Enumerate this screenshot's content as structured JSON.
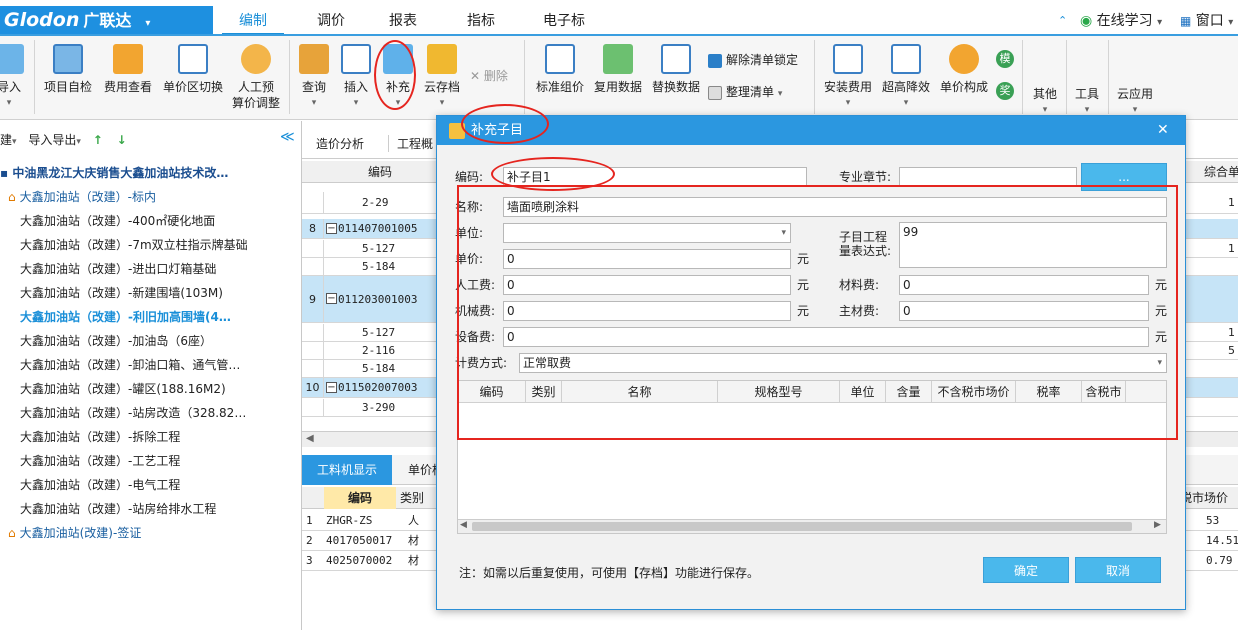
{
  "app": {
    "logo": "Glodon",
    "logo_cn": "广联达",
    "logo_caret": "▾"
  },
  "menu_tabs": [
    "编制",
    "调价",
    "报表",
    "指标",
    "电子标"
  ],
  "top_right": {
    "online": "在线学习",
    "window": "窗口"
  },
  "ribbon": {
    "import": "导入",
    "self_check": "项目自检",
    "fee_view": "费用查看",
    "price_zone": "单价区切换",
    "labor_adjust_1": "人工预",
    "labor_adjust_2": "算价调整",
    "query": "查询",
    "insert": "插入",
    "supplement": "补充",
    "cloud_save": "云存档",
    "delete": "删除",
    "std_price": "标准组价",
    "reuse": "复用数据",
    "replace": "替换数据",
    "unlock": "解除清单锁定",
    "organize": "整理清单",
    "install": "安装费用",
    "high_reduce": "超高降效",
    "price_comp": "单价构成",
    "other": "其他",
    "tools": "工具",
    "cloud": "云应用",
    "mo": "模",
    "jiang": "奖",
    "caret": "▾"
  },
  "left": {
    "toolbar": {
      "build": "建",
      "import_export": "导入导出",
      "up": "↑",
      "down": "↓",
      "collapse": "≪"
    },
    "tree": [
      {
        "label": "中油黑龙江大庆销售大鑫加油站技术改…",
        "style": "bold",
        "icon": false
      },
      {
        "label": "大鑫加油站（改建）-标内",
        "style": "blue",
        "icon": true
      },
      {
        "label": "大鑫加油站（改建）-400㎡硬化地面",
        "style": "",
        "icon": false
      },
      {
        "label": "大鑫加油站（改建）-7m双立柱指示牌基础",
        "style": "",
        "icon": false
      },
      {
        "label": "大鑫加油站（改建）-进出口灯箱基础",
        "style": "",
        "icon": false
      },
      {
        "label": "大鑫加油站（改建）-新建围墙(103M)",
        "style": "",
        "icon": false
      },
      {
        "label": "大鑫加油站（改建）-利旧加高围墙(4…",
        "style": "sel",
        "icon": false
      },
      {
        "label": "大鑫加油站（改建）-加油岛（6座）",
        "style": "",
        "icon": false
      },
      {
        "label": "大鑫加油站（改建）-卸油口箱、通气管…",
        "style": "",
        "icon": false
      },
      {
        "label": "大鑫加油站（改建）-罐区(188.16M2)",
        "style": "",
        "icon": false
      },
      {
        "label": "大鑫加油站（改建）-站房改造（328.82…",
        "style": "",
        "icon": false
      },
      {
        "label": "大鑫加油站（改建）-拆除工程",
        "style": "",
        "icon": false
      },
      {
        "label": "大鑫加油站（改建）-工艺工程",
        "style": "",
        "icon": false
      },
      {
        "label": "大鑫加油站（改建）-电气工程",
        "style": "",
        "icon": false
      },
      {
        "label": "大鑫加油站（改建）-站房给排水工程",
        "style": "",
        "icon": false
      },
      {
        "label": "大鑫加油站(改建)-签证",
        "style": "blue",
        "icon": true
      }
    ]
  },
  "grid": {
    "tabs": [
      "造价分析",
      "工程概"
    ],
    "col_code": "编码",
    "col_right": "综合单",
    "rows": [
      {
        "num": "",
        "code": "2-29",
        "blue": false,
        "right": "1"
      },
      {
        "num": "8",
        "code": "011407001005",
        "blue": true,
        "right": ""
      },
      {
        "num": "",
        "code": "5-127",
        "blue": false,
        "right": "1"
      },
      {
        "num": "",
        "code": "5-184",
        "blue": false,
        "right": ""
      },
      {
        "num": "9",
        "code": "011203001003",
        "blue": true,
        "right": ""
      },
      {
        "num": "",
        "code": "5-127",
        "blue": false,
        "right": "1"
      },
      {
        "num": "",
        "code": "2-116",
        "blue": false,
        "right": "5"
      },
      {
        "num": "",
        "code": "5-184",
        "blue": false,
        "right": ""
      },
      {
        "num": "10",
        "code": "011502007003",
        "blue": true,
        "right": ""
      },
      {
        "num": "",
        "code": "3-290",
        "blue": false,
        "right": ""
      }
    ],
    "bottom_tabs": [
      "工料机显示",
      "单价构"
    ],
    "bottom_cols": {
      "code": "编码",
      "type": "类别",
      "price": "税市场价"
    },
    "bottom_rows": [
      {
        "num": "1",
        "code": "ZHGR-ZS",
        "type": "人",
        "price": "53"
      },
      {
        "num": "2",
        "code": "4017050017",
        "type": "材",
        "price": "14.51"
      },
      {
        "num": "3",
        "code": "4025070002",
        "type": "材",
        "price": "0.79"
      }
    ]
  },
  "dialog": {
    "title": "补充子目",
    "close": "✕",
    "code_label": "编码:",
    "code_value": "补子目1",
    "chapter_label": "专业章节:",
    "chapter_value": "",
    "browse": "...",
    "name_label": "名称:",
    "name_value": "墙面喷刷涂料",
    "unit_label": "单位:",
    "unit_value": "",
    "qty_expr_label_1": "子目工程",
    "qty_expr_label_2": "量表达式:",
    "qty_expr_value": "99",
    "price_label": "单价:",
    "price_value": "0",
    "labor_label": "人工费:",
    "labor_value": "0",
    "material_label": "材料费:",
    "material_value": "0",
    "machine_label": "机械费:",
    "machine_value": "0",
    "main_mat_label": "主材费:",
    "main_mat_value": "0",
    "equip_label": "设备费:",
    "equip_value": "0",
    "yuan": "元",
    "fee_mode_label": "计费方式:",
    "fee_mode_value": "正常取费",
    "table_cols": [
      "编码",
      "类别",
      "名称",
      "规格型号",
      "单位",
      "含量",
      "不含税市场价",
      "税率",
      "含税市"
    ],
    "note": "注：如需以后重复使用，可使用【存档】功能进行保存。",
    "ok": "确定",
    "cancel": "取消"
  },
  "colors": {
    "accent": "#2b97e0",
    "highlight_red": "#e5251f",
    "row_blue": "#c6e4f7"
  }
}
